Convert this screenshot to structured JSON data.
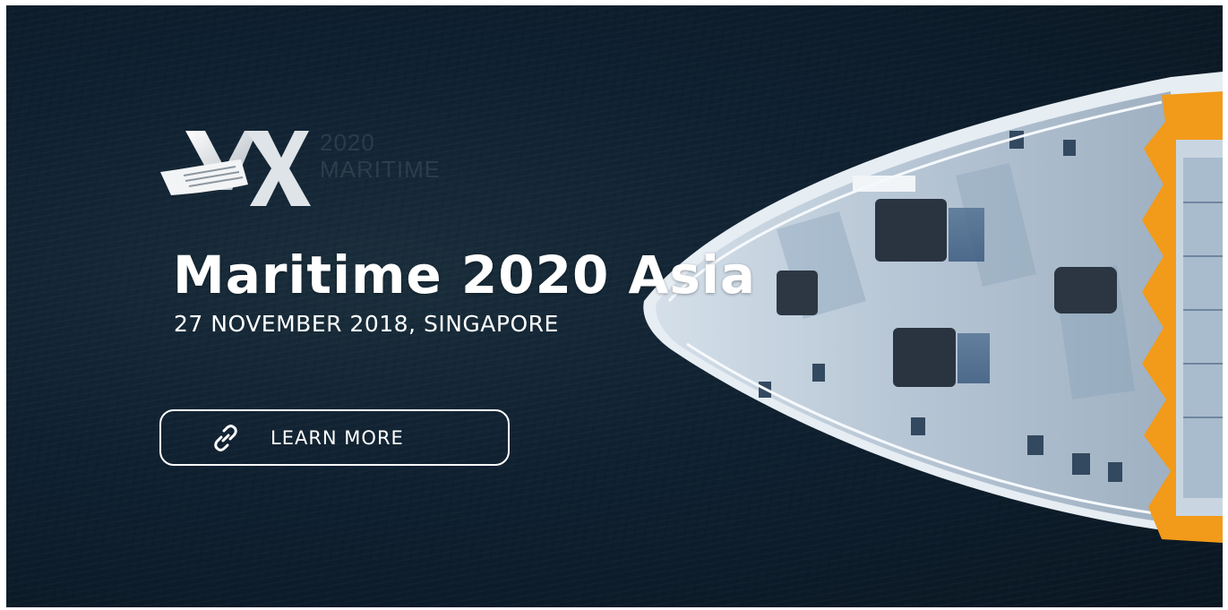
{
  "banner": {
    "title": "Maritime 2020 Asia",
    "subtitle": "27 NOVEMBER 2018, SINGAPORE",
    "cta_label": "LEARN MORE",
    "cta_icon": "link-icon",
    "background_image": "aerial view of a ship's bow on dark sea"
  },
  "logo": {
    "line1": "2020",
    "line2": "MARITIME",
    "mark": "vx-ship-logo"
  },
  "colors": {
    "sea": "#0f2030",
    "deck": "#b4c4d4",
    "hull_accent": "#f29a1a",
    "text": "#ffffff"
  }
}
